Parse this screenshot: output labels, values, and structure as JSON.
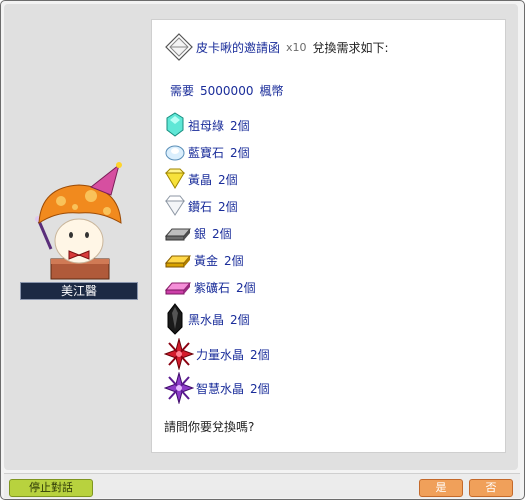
{
  "npc": {
    "name": "美江醫"
  },
  "header": {
    "item_name": "皮卡啾的邀請函",
    "quantity": "x10",
    "suffix": "兌換需求如下:"
  },
  "mesos": {
    "label": "需要",
    "amount": "5000000",
    "unit": "楓幣"
  },
  "items": [
    {
      "name": "祖母綠",
      "count": "2個",
      "icon": "emerald-icon"
    },
    {
      "name": "藍寶石",
      "count": "2個",
      "icon": "sapphire-icon"
    },
    {
      "name": "黃晶",
      "count": "2個",
      "icon": "topaz-icon"
    },
    {
      "name": "鑽石",
      "count": "2個",
      "icon": "diamond-icon"
    },
    {
      "name": "銀",
      "count": "2個",
      "icon": "silver-icon"
    },
    {
      "name": "黃金",
      "count": "2個",
      "icon": "gold-icon"
    },
    {
      "name": "紫礦石",
      "count": "2個",
      "icon": "amethyst-icon"
    },
    {
      "name": "黑水晶",
      "count": "2個",
      "icon": "black-crystal-icon"
    },
    {
      "name": "力量水晶",
      "count": "2個",
      "icon": "power-crystal-icon"
    },
    {
      "name": "智慧水晶",
      "count": "2個",
      "icon": "wisdom-crystal-icon"
    }
  ],
  "question": "請問你要兌換嗎?",
  "buttons": {
    "stop": "停止對話",
    "yes": "是",
    "no": "否"
  }
}
